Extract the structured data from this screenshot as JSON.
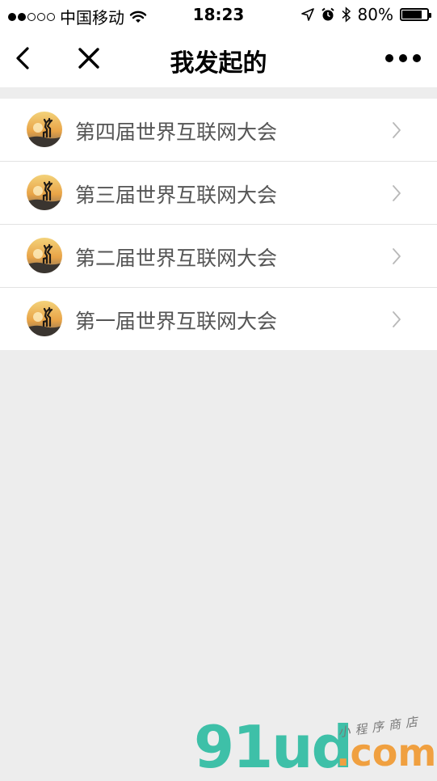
{
  "status_bar": {
    "carrier": "中国移动",
    "time": "18:23",
    "battery_percent": "80%",
    "battery_level": 0.8,
    "signal_dots_filled": 2,
    "signal_dots_total": 5
  },
  "nav": {
    "title": "我发起的"
  },
  "list": {
    "items": [
      {
        "label": "第四届世界互联网大会"
      },
      {
        "label": "第三届世界互联网大会"
      },
      {
        "label": "第二届世界互联网大会"
      },
      {
        "label": "第一届世界互联网大会"
      }
    ]
  },
  "watermark": {
    "brand": "91ud",
    "domain": ".com",
    "tagline": "小程序商店"
  },
  "colors": {
    "background": "#ededed",
    "list_text": "#555555",
    "watermark_green": "#3ec0a8",
    "watermark_orange": "#f0a040"
  }
}
